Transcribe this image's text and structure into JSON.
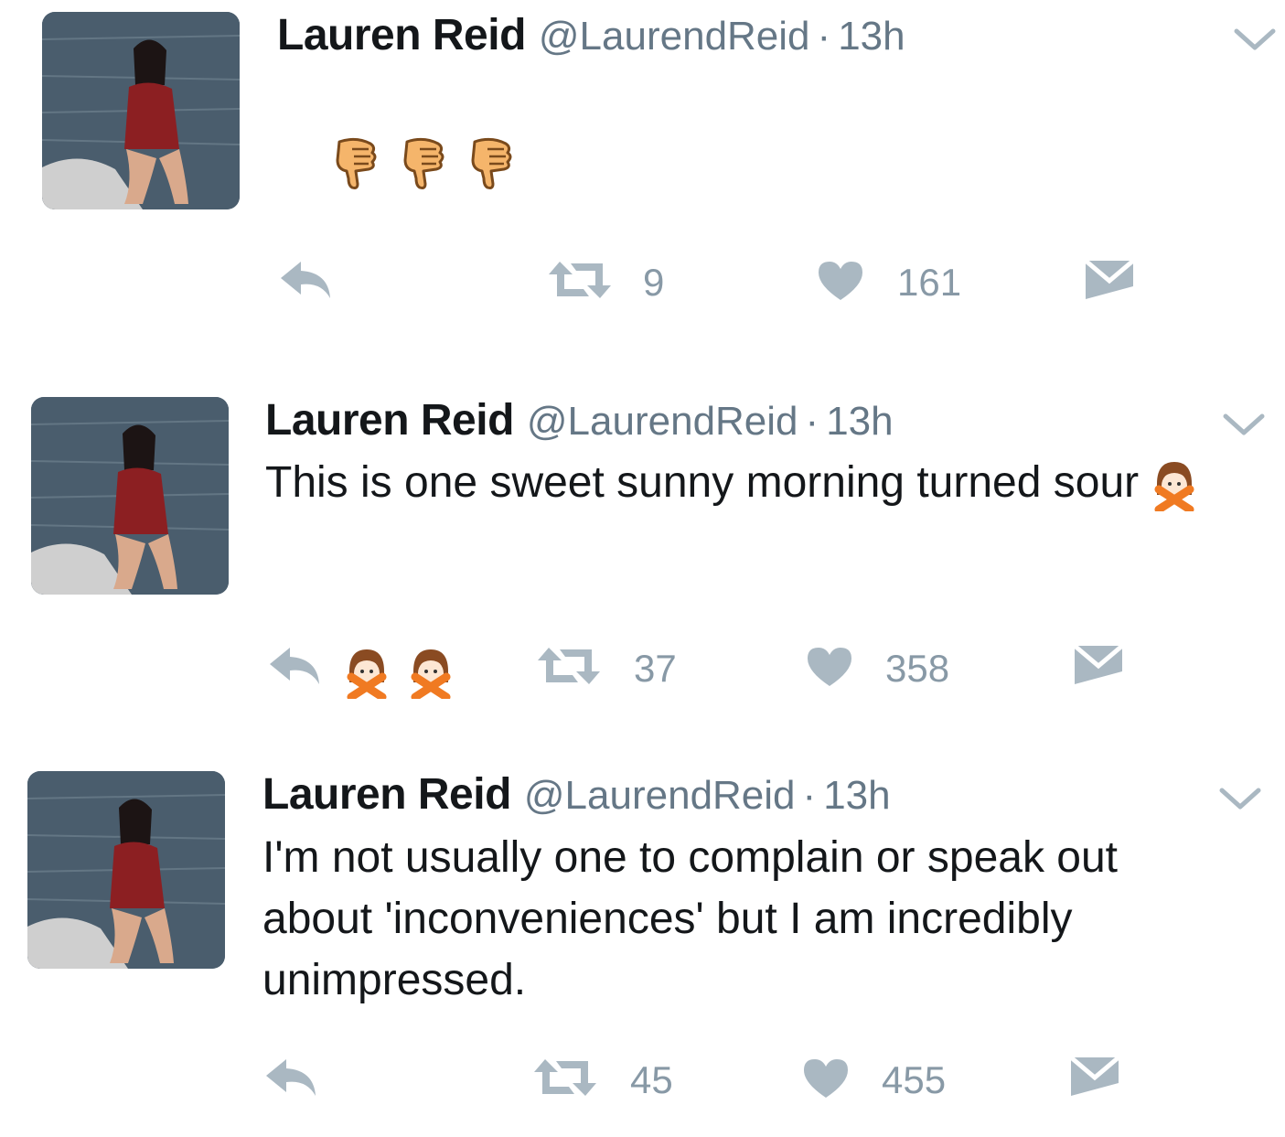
{
  "tweets": [
    {
      "name": "Lauren Reid",
      "handle": "@LaurendReid",
      "separator": "·",
      "time": "13h",
      "text": "",
      "emoji": [
        "thumbs-down",
        "thumbs-down",
        "thumbs-down"
      ],
      "retweets": "9",
      "likes": "161"
    },
    {
      "name": "Lauren Reid",
      "handle": "@LaurendReid",
      "separator": "·",
      "time": "13h",
      "text": "This is one sweet sunny morning turned sour",
      "emoji": [
        "no-gesture-girl",
        "no-gesture-girl",
        "no-gesture-girl"
      ],
      "retweets": "37",
      "likes": "358"
    },
    {
      "name": "Lauren Reid",
      "handle": "@LaurendReid",
      "separator": "·",
      "time": "13h",
      "text": "I'm not usually one to complain or speak out about 'inconveniences' but I am incredibly unimpressed.",
      "emoji": [],
      "retweets": "45",
      "likes": "455"
    }
  ],
  "colors": {
    "icon": "#aab8c2",
    "muted": "#657786",
    "count": "#8899a6",
    "text": "#14171a"
  },
  "icons": [
    "reply-icon",
    "retweet-icon",
    "like-icon",
    "dm-icon",
    "chevron-down-icon"
  ]
}
